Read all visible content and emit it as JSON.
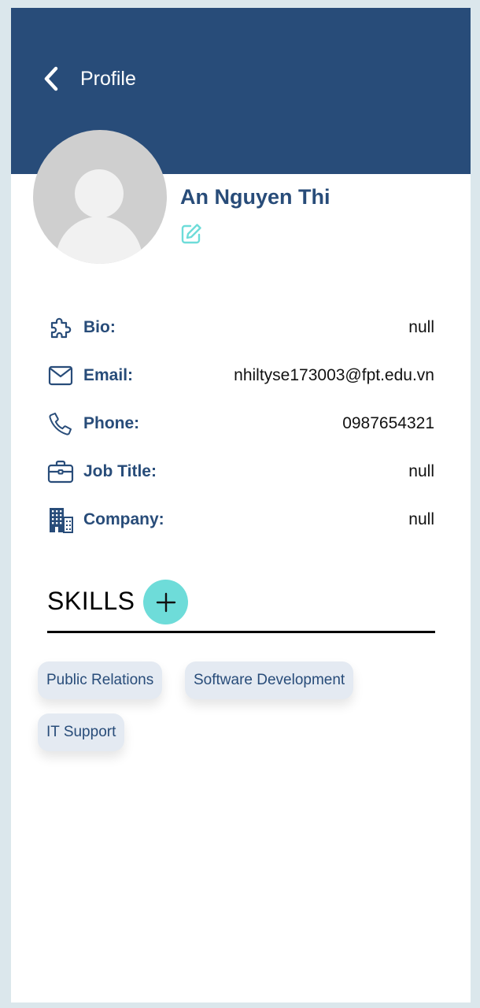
{
  "header": {
    "title": "Profile",
    "background": "#284c79"
  },
  "user": {
    "name": "An Nguyen Thi"
  },
  "info": [
    {
      "icon": "puzzle-icon",
      "label": "Bio:",
      "value": "null"
    },
    {
      "icon": "mail-icon",
      "label": "Email:",
      "value": "nhiltyse173003@fpt.edu.vn"
    },
    {
      "icon": "phone-icon",
      "label": "Phone:",
      "value": "0987654321"
    },
    {
      "icon": "briefcase-icon",
      "label": "Job Title:",
      "value": "null"
    },
    {
      "icon": "building-icon",
      "label": "Company:",
      "value": "null"
    }
  ],
  "skills": {
    "title": "SKILLS",
    "items": [
      "Public Relations",
      "Software Development",
      "IT Support"
    ]
  },
  "colors": {
    "primary": "#284c79",
    "accent": "#6edcd9",
    "chip": "#e4eaf2",
    "page_background": "#dbe7ec"
  }
}
